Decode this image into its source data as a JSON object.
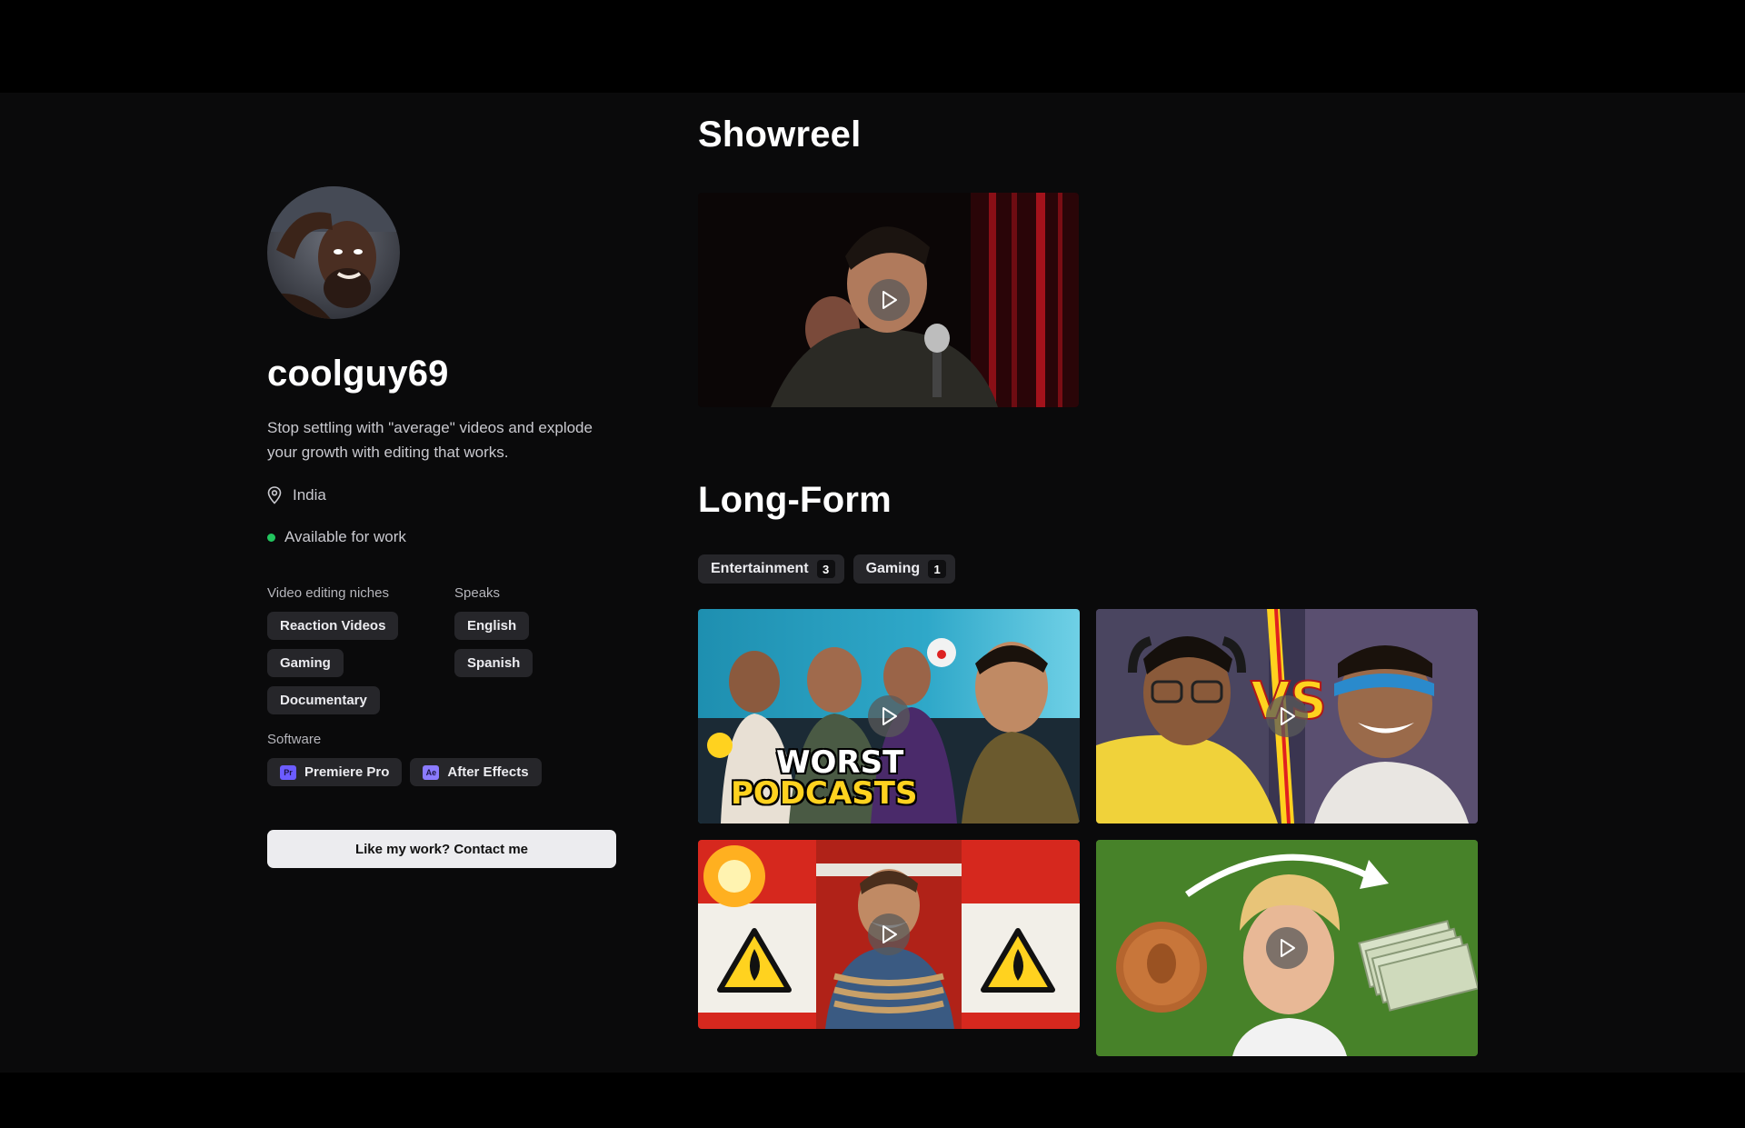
{
  "profile": {
    "username": "coolguy69",
    "bio": "Stop settling with \"average\" videos and explode your growth with editing that works.",
    "location": "India",
    "availability": "Available for work",
    "availability_color": "#22c55e",
    "niches_label": "Video editing niches",
    "niches": [
      "Reaction Videos",
      "Gaming",
      "Documentary"
    ],
    "speaks_label": "Speaks",
    "languages": [
      "English",
      "Spanish"
    ],
    "software_label": "Software",
    "software": [
      {
        "badge": "Pr",
        "name": "Premiere Pro"
      },
      {
        "badge": "Ae",
        "name": "After Effects"
      }
    ],
    "contact_label": "Like my work? Contact me"
  },
  "showreel": {
    "title": "Showreel"
  },
  "longform": {
    "title": "Long-Form",
    "filters": [
      {
        "label": "Entertainment",
        "count": "3"
      },
      {
        "label": "Gaming",
        "count": "1"
      }
    ],
    "video1_text_line1": "WORST",
    "video1_text_line2": "PODCASTS",
    "video2_text": "VS"
  },
  "colors": {
    "background": "#0a0a0b",
    "chip_bg": "#26262a",
    "button_bg": "#ececef",
    "software_badge": "#6c5cff"
  }
}
